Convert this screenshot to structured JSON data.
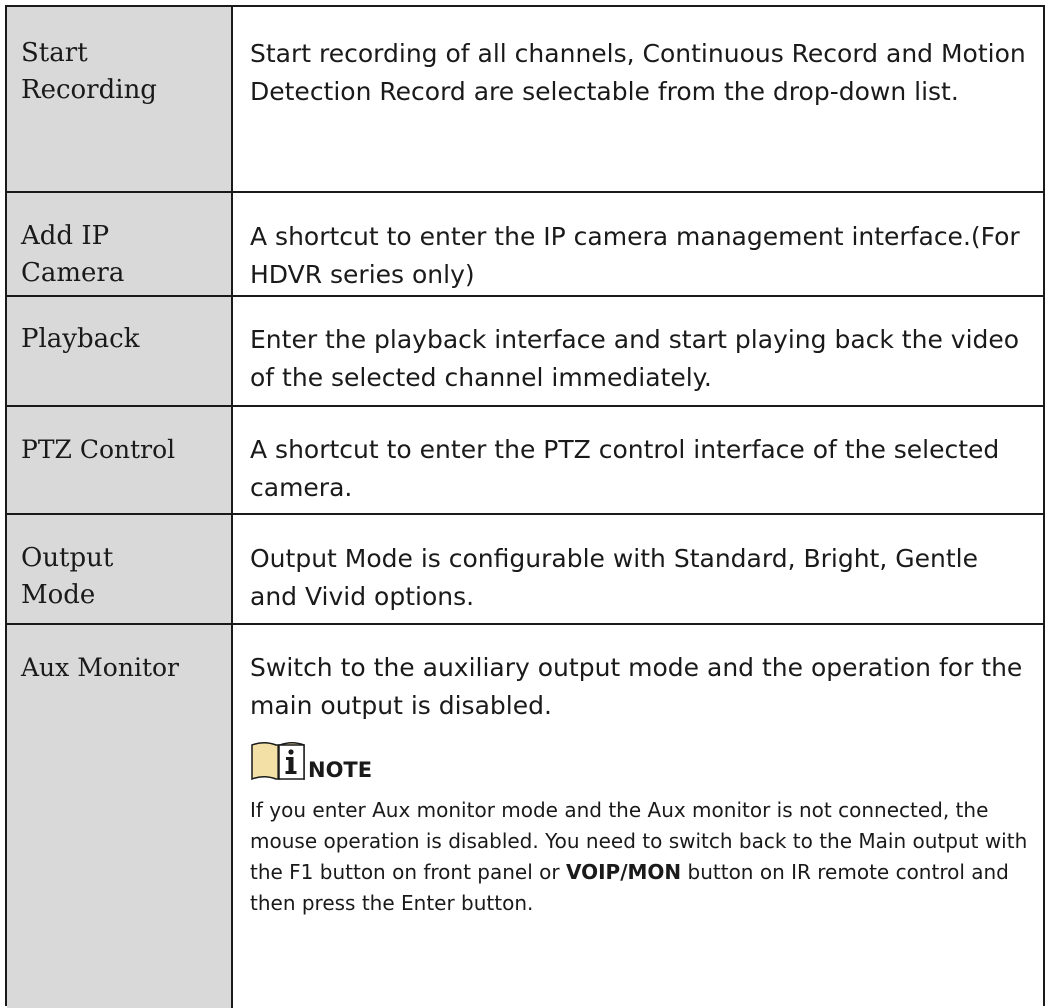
{
  "rows": [
    {
      "label": "Start Recording",
      "description": "Start recording of all channels, Continuous Record and Motion Detection Record are selectable from the drop-down list."
    },
    {
      "label": "Add IP Camera",
      "description": "A shortcut to enter the IP camera management interface.(For HDVR series only)"
    },
    {
      "label": "Playback",
      "description": "Enter the playback interface and start playing back the video of the selected channel immediately."
    },
    {
      "label": "PTZ Control",
      "description": "A shortcut to enter the PTZ control interface of the selected camera."
    },
    {
      "label": "Output Mode",
      "description": "Output Mode is configurable with Standard, Bright, Gentle and Vivid options."
    },
    {
      "label": "Aux Monitor",
      "description": "Switch to the auxiliary output mode and the operation for the main output is disabled."
    }
  ],
  "note": {
    "icon": "info-note-icon",
    "label": "NOTE",
    "text_part1": " If you enter Aux monitor mode and the Aux monitor is not connected, the mouse operation is disabled. You need to switch back to the Main output with the F1 button on front panel or ",
    "bold": "VOIP/MON",
    "text_part2": " button on IR remote control and then press the Enter button."
  },
  "colors": {
    "label_background": "#d9d9d9",
    "border": "#1a1a1a",
    "note_icon_fill": "#f2e0a6"
  }
}
